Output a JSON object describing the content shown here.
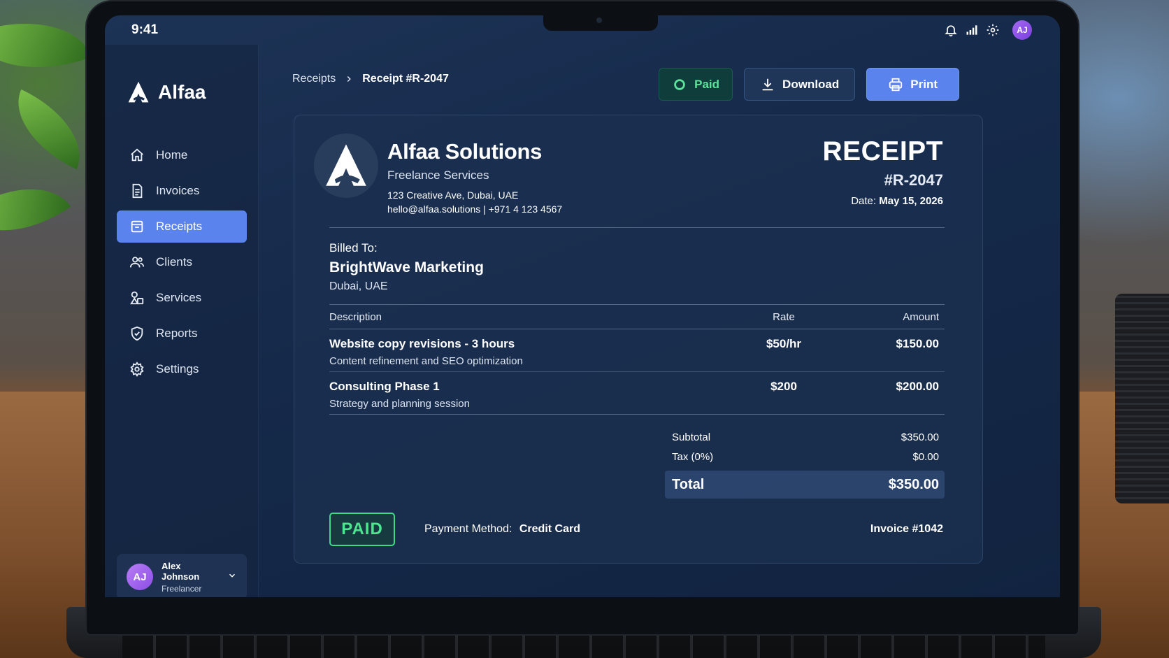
{
  "status_bar": {
    "time": "9:41",
    "avatar_initials": "AJ"
  },
  "brand": {
    "name": "Alfaa"
  },
  "sidebar": {
    "items": [
      {
        "label": "Home",
        "icon": "home-icon",
        "active": false
      },
      {
        "label": "Invoices",
        "icon": "document-icon",
        "active": false
      },
      {
        "label": "Receipts",
        "icon": "receipt-icon",
        "active": true
      },
      {
        "label": "Clients",
        "icon": "users-icon",
        "active": false
      },
      {
        "label": "Services",
        "icon": "shapes-icon",
        "active": false
      },
      {
        "label": "Reports",
        "icon": "shield-check-icon",
        "active": false
      },
      {
        "label": "Settings",
        "icon": "gear-icon",
        "active": false
      }
    ],
    "user": {
      "initials": "AJ",
      "name": "Alex Johnson",
      "role": "Freelancer"
    }
  },
  "breadcrumb": {
    "parent": "Receipts",
    "current": "Receipt #R-2047"
  },
  "actions": {
    "paid_label": "Paid",
    "download_label": "Download",
    "print_label": "Print"
  },
  "receipt": {
    "company_name": "Alfaa Solutions",
    "company_tagline": "Freelance Services",
    "company_address": "123 Creative Ave, Dubai, UAE",
    "company_contact": "hello@alfaa.solutions | +971 4 123 4567",
    "title": "RECEIPT",
    "number": "#R-2047",
    "date_label": "Date:",
    "date_value": "May 15, 2026",
    "billed_label": "Billed To:",
    "billed_name": "BrightWave Marketing",
    "billed_location": "Dubai, UAE",
    "columns": {
      "description": "Description",
      "rate": "Rate",
      "amount": "Amount"
    },
    "items": [
      {
        "title": "Website copy revisions - 3 hours",
        "subtitle": "Content refinement and SEO optimization",
        "rate": "$50/hr",
        "amount": "$150.00"
      },
      {
        "title": "Consulting Phase 1",
        "subtitle": "Strategy and planning session",
        "rate": "$200",
        "amount": "$200.00"
      }
    ],
    "subtotal_label": "Subtotal",
    "subtotal_value": "$350.00",
    "tax_label": "Tax (0%)",
    "tax_value": "$0.00",
    "total_label": "Total",
    "total_value": "$350.00",
    "stamp": "PAID",
    "payment_method_label": "Payment Method:",
    "payment_method_value": "Credit Card",
    "invoice_ref": "Invoice #1042"
  },
  "colors": {
    "accent": "#5b83ee",
    "paid_green": "#4ee58f",
    "screen_bg": "#15294a"
  }
}
